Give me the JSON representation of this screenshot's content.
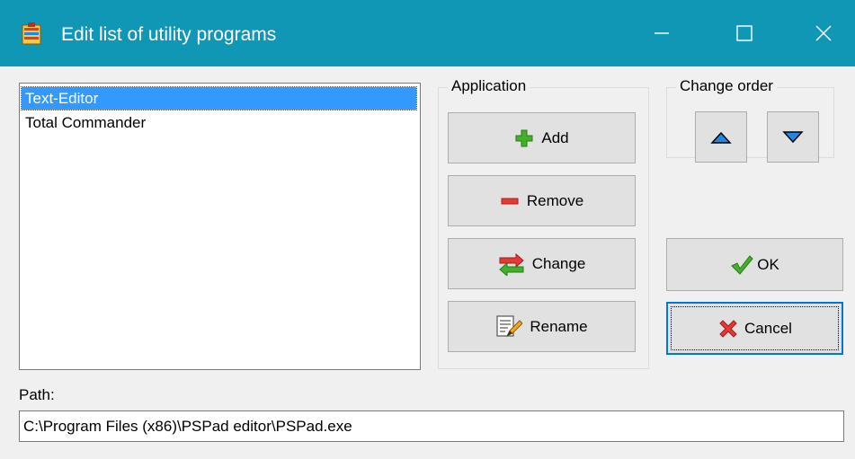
{
  "window": {
    "title": "Edit list of utility programs",
    "icon": "utility-app-icon",
    "controls": [
      "minimize-icon",
      "maximize-icon",
      "close-icon"
    ],
    "titlebar_color": "#1097b6"
  },
  "programs": {
    "items": [
      {
        "label": "Text-Editor",
        "selected": true
      },
      {
        "label": "Total Commander",
        "selected": false
      }
    ]
  },
  "application_group": {
    "title": "Application",
    "buttons": {
      "add": {
        "label": "Add",
        "icon": "plus-icon"
      },
      "remove": {
        "label": "Remove",
        "icon": "minus-icon"
      },
      "change": {
        "label": "Change",
        "icon": "swap-arrows-icon"
      },
      "rename": {
        "label": "Rename",
        "icon": "rename-pencil-icon"
      }
    }
  },
  "order_group": {
    "title": "Change order",
    "up_icon": "arrow-up-icon",
    "down_icon": "arrow-down-icon"
  },
  "dialog": {
    "ok_label": "OK",
    "ok_icon": "checkmark-icon",
    "cancel_label": "Cancel",
    "cancel_icon": "cross-icon"
  },
  "path": {
    "label": "Path:",
    "value": "C:\\Program Files (x86)\\PSPad editor\\PSPad.exe"
  }
}
